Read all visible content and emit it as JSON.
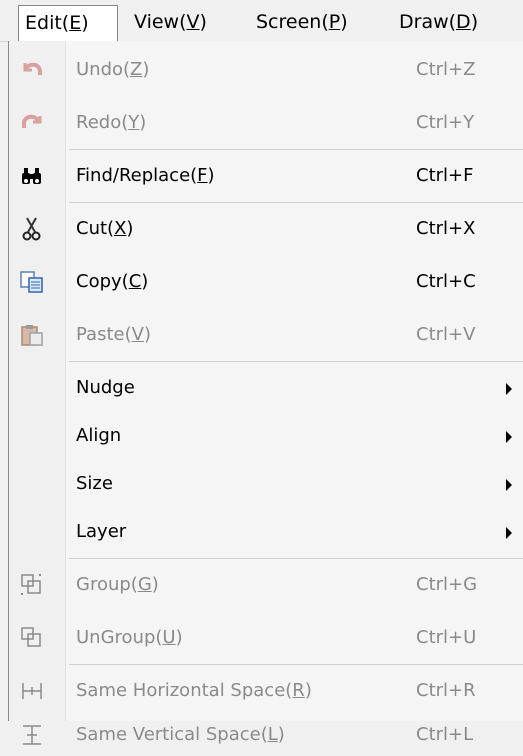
{
  "menubar": {
    "items": [
      {
        "text": "Edit(",
        "key": "E",
        "close": ")"
      },
      {
        "text": "View(",
        "key": "V",
        "close": ")"
      },
      {
        "text": "Screen(",
        "key": "P",
        "close": ")"
      },
      {
        "text": "Draw(",
        "key": "D",
        "close": ")"
      }
    ]
  },
  "menu": {
    "undo": {
      "label": "Undo(",
      "key": "Z",
      "close": ")",
      "shortcut": "Ctrl+Z",
      "icon": "undo-icon",
      "enabled": false
    },
    "redo": {
      "label": "Redo(",
      "key": "Y",
      "close": ")",
      "shortcut": "Ctrl+Y",
      "icon": "redo-icon",
      "enabled": false
    },
    "find": {
      "label": "Find/Replace(",
      "key": "F",
      "close": ")",
      "shortcut": "Ctrl+F",
      "icon": "binoculars-icon",
      "enabled": true
    },
    "cut": {
      "label": "Cut(",
      "key": "X",
      "close": ")",
      "shortcut": "Ctrl+X",
      "icon": "scissors-icon",
      "enabled": true
    },
    "copy": {
      "label": "Copy(",
      "key": "C",
      "close": ")",
      "shortcut": "Ctrl+C",
      "icon": "copy-icon",
      "enabled": true
    },
    "paste": {
      "label": "Paste(",
      "key": "V",
      "close": ")",
      "shortcut": "Ctrl+V",
      "icon": "paste-icon",
      "enabled": false
    },
    "nudge": {
      "label": "Nudge"
    },
    "align": {
      "label": "Align"
    },
    "size": {
      "label": "Size"
    },
    "layer": {
      "label": "Layer"
    },
    "group": {
      "label": "Group(",
      "key": "G",
      "close": ")",
      "shortcut": "Ctrl+G",
      "icon": "group-icon",
      "enabled": false
    },
    "ungroup": {
      "label": "UnGroup(",
      "key": "U",
      "close": ")",
      "shortcut": "Ctrl+U",
      "icon": "ungroup-icon",
      "enabled": false
    },
    "same_h": {
      "label": "Same Horizontal Space(",
      "key": "R",
      "close": ")",
      "shortcut": "Ctrl+R",
      "icon": "horizontal-space-icon",
      "enabled": false
    },
    "same_v": {
      "label": "Same Vertical Space(",
      "key": "L",
      "close": ")",
      "shortcut": "Ctrl+L",
      "icon": "vertical-space-icon",
      "enabled": false
    }
  },
  "colors": {
    "disabled_text": "#8a8a8a",
    "menu_background": "#f5f5f5",
    "gutter": "#f0f0f0"
  }
}
